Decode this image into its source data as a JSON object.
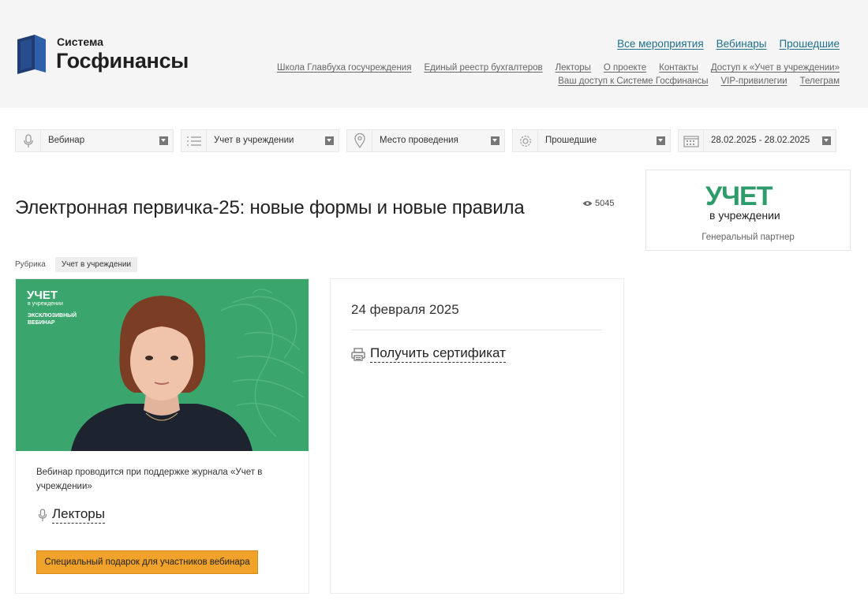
{
  "logo": {
    "small": "Система",
    "big": "Госфинансы"
  },
  "top_nav": [
    "Все мероприятия",
    "Вебинары",
    "Прошедшие"
  ],
  "sub_nav_row1": [
    "Школа Главбуха госучреждения",
    "Единый реестр бухгалтеров",
    "Лекторы",
    "О проекте",
    "Контакты",
    "Доступ к «Учет в учреждении»"
  ],
  "sub_nav_row2": [
    "Ваш доступ к Системе Госфинансы",
    "VIP-привилегии",
    "Телеграм"
  ],
  "filters": [
    {
      "icon": "microphone-icon",
      "value": "Вебинар"
    },
    {
      "icon": "list-icon",
      "value": "Учет в учреждении"
    },
    {
      "icon": "location-pin-icon",
      "value": "Место проведения"
    },
    {
      "icon": "gear-icon",
      "value": "Прошедшие"
    },
    {
      "icon": "calendar-icon",
      "value": "28.02.2025 - 28.02.2025"
    }
  ],
  "event": {
    "title": "Электронная первичка-25: новые формы и новые правила",
    "views": "5045",
    "rubric_label": "Рубрика",
    "rubric_tag": "Учет в учреждении",
    "date": "24 февраля 2025",
    "certificate": "Получить сертификат",
    "support_text": "Вебинар проводится при поддержке журнала «Учет в учреждении»",
    "lectors_label": "Лекторы",
    "gift_button": "Специальный подарок для участников вебинара"
  },
  "banner": {
    "brand": "УЧЕТ",
    "brand_sub": "в учреждении",
    "line1": "ЭКСКЛЮЗИВНЫЙ",
    "line2": "ВЕБИНАР"
  },
  "partner": {
    "logo": "УЧЕТ",
    "logo_sub": "в учреждении",
    "caption": "Генеральный партнер"
  },
  "colors": {
    "link": "#1d6f8c",
    "accent_green": "#2e9c6a",
    "banner_green": "#3aa56c",
    "button_orange": "#f0a22a"
  }
}
